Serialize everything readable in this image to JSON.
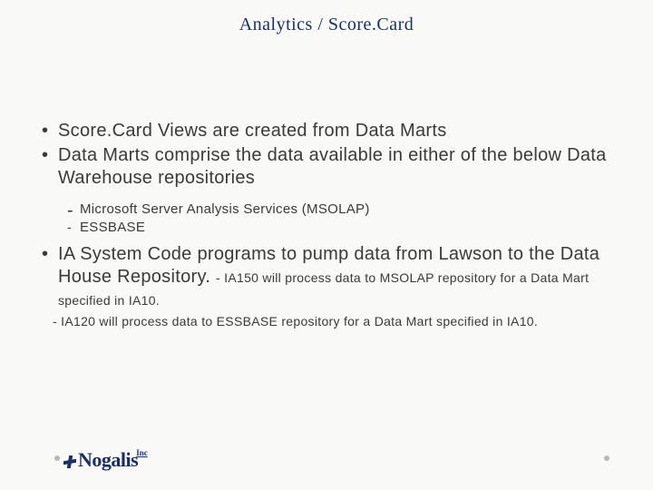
{
  "title": "Analytics /  Score.Card",
  "bullet1": "Score.Card Views are created from Data Marts",
  "bullet2": "Data Marts comprise the data available in either of the below Data Warehouse repositories",
  "sub1": "Microsoft Server Analysis Services  (MSOLAP)",
  "sub2": "ESSBASE",
  "bullet3_main": "IA System Code programs to pump data from Lawson to the Data House Repository. ",
  "bullet3_note": "- IA150 will process data to  MSOLAP repository for a Data Mart specified in IA10.",
  "note2": "- IA120 will process data to  ESSBASE repository for a Data Mart specified in IA10.",
  "logo": {
    "name": "Nogalis",
    "suffix": "Inc"
  }
}
